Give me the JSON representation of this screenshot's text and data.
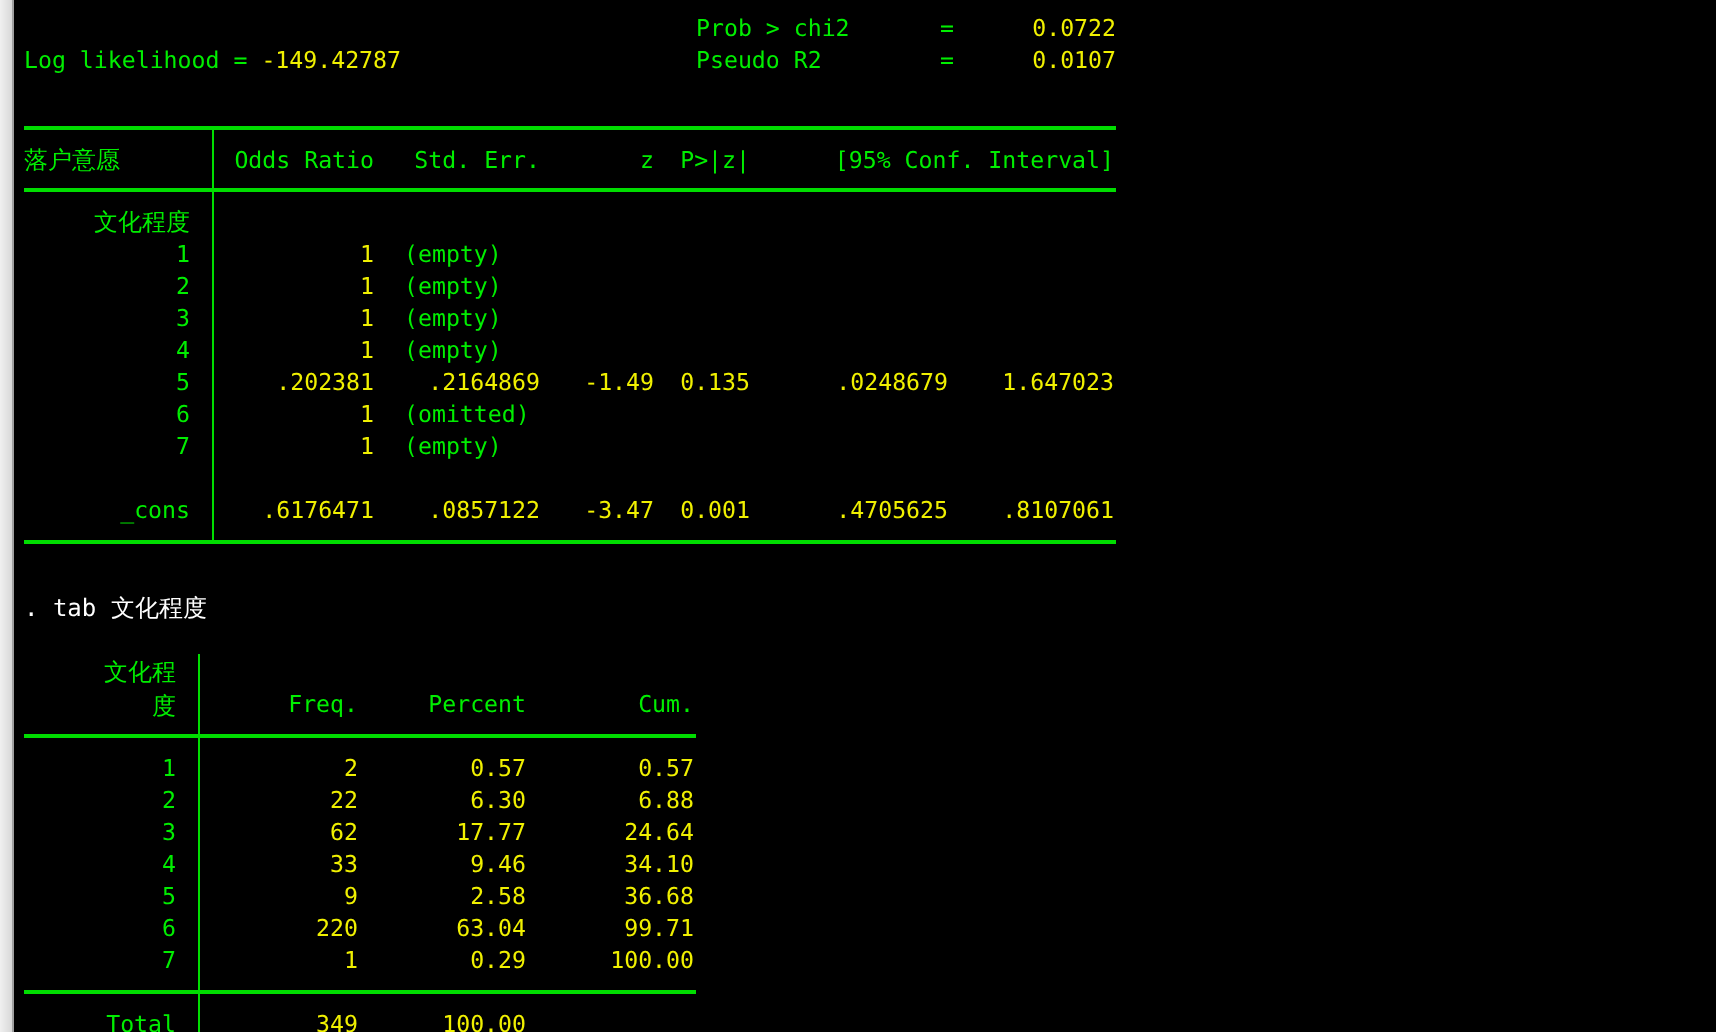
{
  "header_stats": [
    {
      "label": "Prob > chi2",
      "sign": "=",
      "value": "0.0722"
    },
    {
      "label": "Pseudo R2",
      "sign": "=",
      "value": "0.0107"
    }
  ],
  "log_likelihood": {
    "label": "Log likelihood =",
    "value": "-149.42787"
  },
  "regression": {
    "dependent": "落户意愿",
    "columns": [
      "Odds Ratio",
      "Std. Err.",
      "z",
      "P>|z|",
      "[95% Conf. Interval]"
    ],
    "factor": "文化程度",
    "rows": [
      {
        "kind": "note",
        "label": "1",
        "odds_ratio": "1",
        "note": "(empty)"
      },
      {
        "kind": "note",
        "label": "2",
        "odds_ratio": "1",
        "note": "(empty)"
      },
      {
        "kind": "note",
        "label": "3",
        "odds_ratio": "1",
        "note": "(empty)"
      },
      {
        "kind": "note",
        "label": "4",
        "odds_ratio": "1",
        "note": "(empty)"
      },
      {
        "kind": "estimate",
        "label": "5",
        "values": [
          ".202381",
          ".2164869",
          "-1.49",
          "0.135",
          ".0248679",
          "1.647023"
        ]
      },
      {
        "kind": "note",
        "label": "6",
        "odds_ratio": "1",
        "note": "(omitted)"
      },
      {
        "kind": "note",
        "label": "7",
        "odds_ratio": "1",
        "note": "(empty)"
      }
    ],
    "constant": {
      "label": "_cons",
      "values": [
        ".6176471",
        ".0857122",
        "-3.47",
        "0.001",
        ".4705625",
        ".8107061"
      ]
    }
  },
  "command": ". tab 文化程度",
  "tabulation": {
    "variable": "文化程度",
    "columns": [
      "Freq.",
      "Percent",
      "Cum."
    ],
    "rows": [
      {
        "label": "1",
        "values": [
          "2",
          "0.57",
          "0.57"
        ]
      },
      {
        "label": "2",
        "values": [
          "22",
          "6.30",
          "6.88"
        ]
      },
      {
        "label": "3",
        "values": [
          "62",
          "17.77",
          "24.64"
        ]
      },
      {
        "label": "4",
        "values": [
          "33",
          "9.46",
          "34.10"
        ]
      },
      {
        "label": "5",
        "values": [
          "9",
          "2.58",
          "36.68"
        ]
      },
      {
        "label": "6",
        "values": [
          "220",
          "63.04",
          "99.71"
        ]
      },
      {
        "label": "7",
        "values": [
          "1",
          "0.29",
          "100.00"
        ]
      }
    ],
    "total": {
      "label": "Total",
      "values": [
        "349",
        "100.00"
      ]
    }
  }
}
